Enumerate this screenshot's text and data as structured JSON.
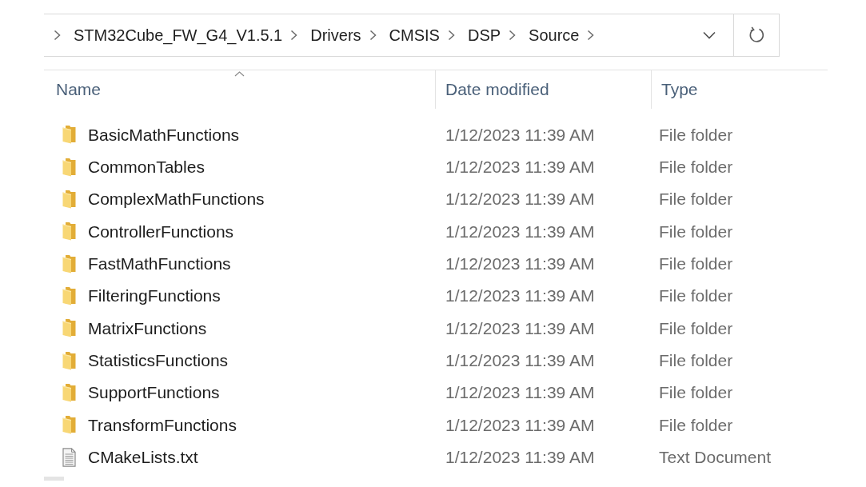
{
  "address_bar": {
    "path": [
      "STM32Cube_FW_G4_V1.5.1",
      "Drivers",
      "CMSIS",
      "DSP",
      "Source"
    ]
  },
  "columns": [
    {
      "label": "Name",
      "sorted": true
    },
    {
      "label": "Date modified",
      "sorted": false
    },
    {
      "label": "Type",
      "sorted": false
    }
  ],
  "rows": [
    {
      "kind": "folder",
      "name": "BasicMathFunctions",
      "date_modified": "1/12/2023 11:39 AM",
      "type": "File folder"
    },
    {
      "kind": "folder",
      "name": "CommonTables",
      "date_modified": "1/12/2023 11:39 AM",
      "type": "File folder"
    },
    {
      "kind": "folder",
      "name": "ComplexMathFunctions",
      "date_modified": "1/12/2023 11:39 AM",
      "type": "File folder"
    },
    {
      "kind": "folder",
      "name": "ControllerFunctions",
      "date_modified": "1/12/2023 11:39 AM",
      "type": "File folder"
    },
    {
      "kind": "folder",
      "name": "FastMathFunctions",
      "date_modified": "1/12/2023 11:39 AM",
      "type": "File folder"
    },
    {
      "kind": "folder",
      "name": "FilteringFunctions",
      "date_modified": "1/12/2023 11:39 AM",
      "type": "File folder"
    },
    {
      "kind": "folder",
      "name": "MatrixFunctions",
      "date_modified": "1/12/2023 11:39 AM",
      "type": "File folder"
    },
    {
      "kind": "folder",
      "name": "StatisticsFunctions",
      "date_modified": "1/12/2023 11:39 AM",
      "type": "File folder"
    },
    {
      "kind": "folder",
      "name": "SupportFunctions",
      "date_modified": "1/12/2023 11:39 AM",
      "type": "File folder"
    },
    {
      "kind": "folder",
      "name": "TransformFunctions",
      "date_modified": "1/12/2023 11:39 AM",
      "type": "File folder"
    },
    {
      "kind": "text_file",
      "name": "CMakeLists.txt",
      "date_modified": "1/12/2023 11:39 AM",
      "type": "Text Document"
    }
  ]
}
